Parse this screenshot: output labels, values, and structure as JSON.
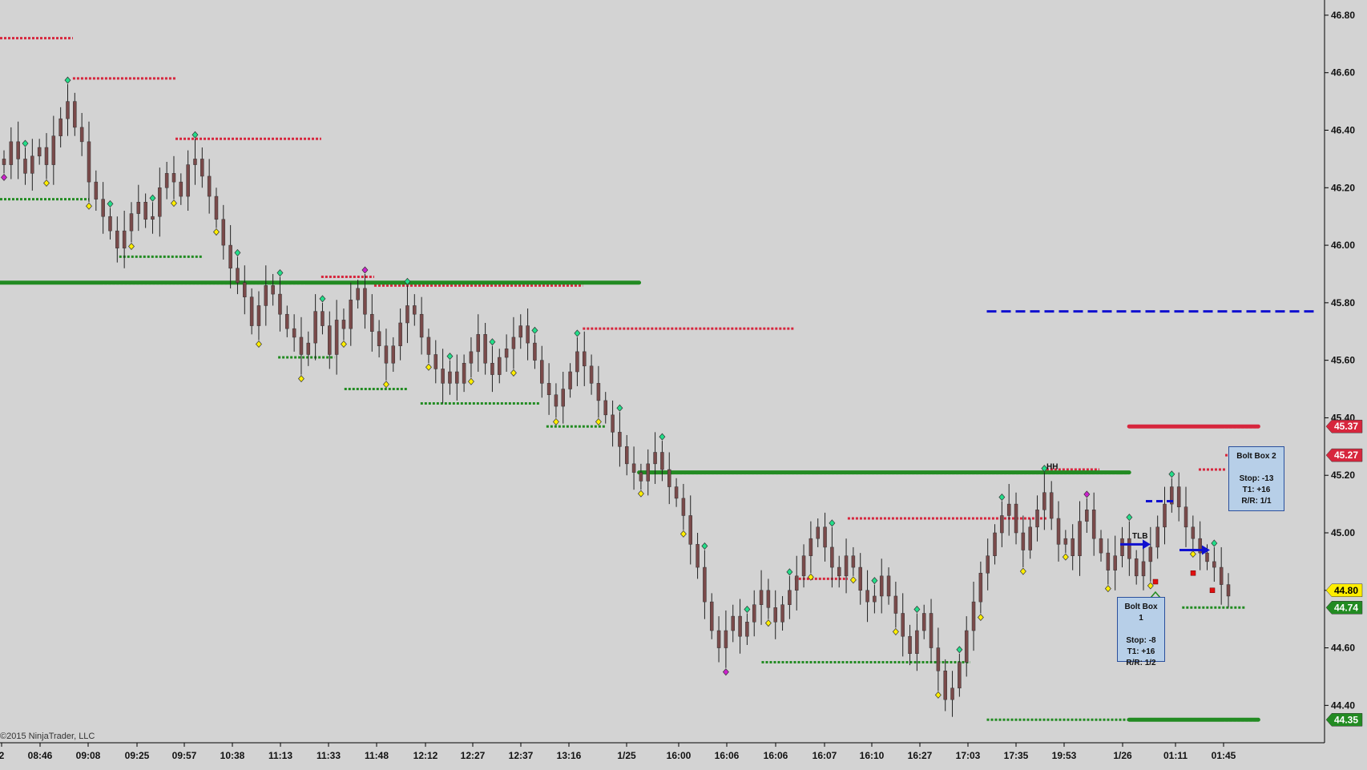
{
  "copyright": "©2015 NinjaTrader, LLC",
  "colors": {
    "background": "#d3d3d3",
    "resistance": "#d7263d",
    "support": "#228b22",
    "target": "#1010d0",
    "candle_body": "#7a4a4a",
    "dot_yellow": "#ffee00",
    "dot_green": "#22dd88",
    "dot_magenta": "#cc22cc"
  },
  "labels": {
    "hh": "HH",
    "tlb": "TLB"
  },
  "bolt_boxes": [
    {
      "title": "Bolt Box 1",
      "stop": "Stop: -8",
      "t1": "T1: +16",
      "rr": "R/R: 1/2"
    },
    {
      "title": "Bolt Box 2",
      "stop": "Stop: -13",
      "t1": "T1: +16",
      "rr": "R/R: 1/1"
    }
  ],
  "chart_data": {
    "type": "candlestick",
    "y_axis": {
      "range": [
        44.27,
        46.85
      ],
      "ticks": [
        "46.80",
        "46.60",
        "46.40",
        "46.20",
        "46.00",
        "45.80",
        "45.60",
        "45.40",
        "45.20",
        "45.00",
        "44.80",
        "44.60",
        "44.40"
      ],
      "price_markers": [
        {
          "label": "45.37",
          "value": 45.37,
          "color": "#d7263d"
        },
        {
          "label": "45.27",
          "value": 45.27,
          "color": "#d7263d"
        },
        {
          "label": "44.80",
          "value": 44.8,
          "color": "#ffee00"
        },
        {
          "label": "44.74",
          "value": 44.74,
          "color": "#228b22"
        },
        {
          "label": "44.35",
          "value": 44.35,
          "color": "#228b22"
        }
      ]
    },
    "x_axis": {
      "range": [
        0,
        1500
      ],
      "ticks": [
        "2",
        "08:46",
        "09:08",
        "09:25",
        "09:57",
        "10:38",
        "11:13",
        "11:33",
        "11:48",
        "12:12",
        "12:27",
        "12:37",
        "13:16",
        "1/25",
        "16:00",
        "16:06",
        "16:06",
        "16:07",
        "16:10",
        "16:27",
        "17:03",
        "17:35",
        "19:53",
        "1/26",
        "01:11",
        "01:45"
      ]
    },
    "closes": [
      46.28,
      46.36,
      46.3,
      46.25,
      46.31,
      46.34,
      46.28,
      46.38,
      46.44,
      46.5,
      46.41,
      46.36,
      46.22,
      46.16,
      46.1,
      46.05,
      45.99,
      46.05,
      46.11,
      46.15,
      46.09,
      46.1,
      46.2,
      46.25,
      46.22,
      46.17,
      46.28,
      46.3,
      46.24,
      46.17,
      46.09,
      46.0,
      45.92,
      45.87,
      45.82,
      45.72,
      45.79,
      45.86,
      45.83,
      45.76,
      45.71,
      45.68,
      45.62,
      45.66,
      45.77,
      45.72,
      45.62,
      45.74,
      45.71,
      45.81,
      45.85,
      45.76,
      45.7,
      45.65,
      45.59,
      45.65,
      45.73,
      45.79,
      45.76,
      45.68,
      45.62,
      45.57,
      45.52,
      45.56,
      45.52,
      45.59,
      45.63,
      45.69,
      45.59,
      45.55,
      45.61,
      45.64,
      45.68,
      45.72,
      45.66,
      45.6,
      45.52,
      45.48,
      45.44,
      45.5,
      45.56,
      45.63,
      45.58,
      45.52,
      45.46,
      45.41,
      45.35,
      45.3,
      45.24,
      45.21,
      45.18,
      45.24,
      45.28,
      45.22,
      45.16,
      45.12,
      45.06,
      44.96,
      44.88,
      44.76,
      44.66,
      44.6,
      44.66,
      44.71,
      44.64,
      44.69,
      44.75,
      44.8,
      44.74,
      44.69,
      44.75,
      44.8,
      44.85,
      44.92,
      44.98,
      45.02,
      44.95,
      44.88,
      44.85,
      44.92,
      44.88,
      44.8,
      44.76,
      44.78,
      44.85,
      44.78,
      44.72,
      44.64,
      44.58,
      44.66,
      44.72,
      44.6,
      44.52,
      44.42,
      44.46,
      44.55,
      44.66,
      44.76,
      44.86,
      44.92,
      45.0,
      45.06,
      45.1,
      45.0,
      44.94,
      45.02,
      45.08,
      45.14,
      45.05,
      44.96,
      44.98,
      44.92,
      45.04,
      45.08,
      44.98,
      44.93,
      44.87,
      44.92,
      44.98,
      44.91,
      44.85,
      44.9,
      44.95,
      45.02,
      45.1,
      45.16,
      45.09,
      45.02,
      44.98,
      44.93,
      44.9,
      44.88,
      44.82,
      44.78
    ],
    "series": [
      {
        "name": "",
        "color": "#d7263d",
        "style": "dotted",
        "segments": [
          [
            0,
            22,
            46.72
          ],
          [
            22,
            53,
            46.58
          ],
          [
            53,
            97,
            46.37
          ],
          [
            97,
            113,
            45.89
          ],
          [
            113,
            176,
            45.86
          ],
          [
            176,
            240,
            45.71
          ],
          [
            240,
            256,
            44.84
          ],
          [
            256,
            316,
            45.05
          ],
          [
            316,
            332,
            45.22
          ],
          [
            362,
            370,
            45.22
          ],
          [
            370,
            380,
            45.27
          ]
        ]
      },
      {
        "name": "",
        "color": "#228b22",
        "style": "dotted",
        "segments": [
          [
            0,
            27,
            46.16
          ],
          [
            36,
            61,
            45.96
          ],
          [
            84,
            101,
            45.61
          ],
          [
            104,
            123,
            45.5
          ],
          [
            127,
            163,
            45.45
          ],
          [
            165,
            183,
            45.37
          ],
          [
            230,
            293,
            44.55
          ],
          [
            298,
            376,
            44.35
          ],
          [
            357,
            376,
            44.74
          ]
        ]
      },
      {
        "name": "",
        "color": "#228b22",
        "style": "dense",
        "segments": [
          [
            0,
            193,
            45.87
          ],
          [
            193,
            341,
            45.21
          ],
          [
            341,
            380,
            44.35
          ]
        ]
      },
      {
        "name": "",
        "color": "#d7263d",
        "style": "dense",
        "segments": [
          [
            341,
            380,
            45.37
          ]
        ]
      },
      {
        "name": "",
        "color": "#1010d0",
        "style": "dashed",
        "segments": [
          [
            298,
            397,
            45.77
          ]
        ]
      }
    ]
  }
}
